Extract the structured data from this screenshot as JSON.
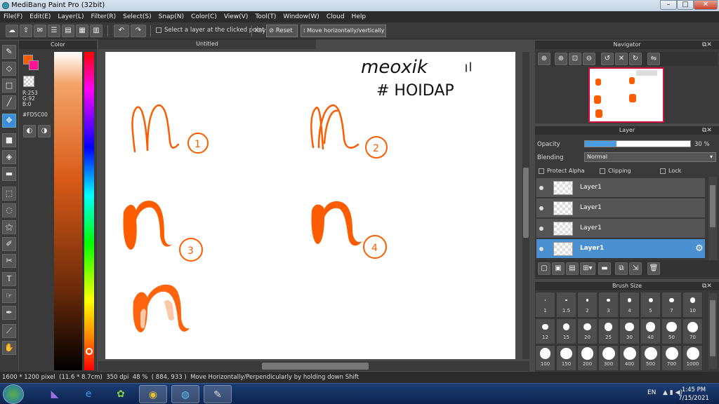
{
  "window": {
    "title": "MediBang Paint Pro (32bit)"
  },
  "menu": [
    "File(F)",
    "Edit(E)",
    "Layer(L)",
    "Filter(R)",
    "Select(S)",
    "Snap(N)",
    "Color(C)",
    "View(V)",
    "Tool(T)",
    "Window(W)",
    "Cloud",
    "Help"
  ],
  "toolbar": {
    "select_layer_label": "Select a layer at the clicked point",
    "key_label": "Key",
    "reset_label": "Reset",
    "move_label": "Move horizontally/vertically"
  },
  "color_panel": {
    "title": "Color",
    "r": "R:253",
    "g": "G:92",
    "b": "B:0",
    "hex": "#FD5C00",
    "fg_color": "#fd5c00",
    "bg_color": "#ff1493"
  },
  "canvas": {
    "tab": "Untitled",
    "handwriting_line1": "meoxik",
    "handwriting_line2": "# HOIDAP",
    "numbers": [
      "1",
      "2",
      "3",
      "4"
    ]
  },
  "navigator": {
    "title": "Navigator"
  },
  "layer_panel": {
    "title": "Layer",
    "opacity_label": "Opacity",
    "opacity_value": "30 %",
    "opacity_fraction": 0.3,
    "blending_label": "Blending",
    "blending_value": "Normal",
    "protect_alpha": "Protect Alpha",
    "clipping": "Clipping",
    "lock": "Lock",
    "layers": [
      "Layer1",
      "Layer1",
      "Layer1",
      "Layer1"
    ]
  },
  "brush_size": {
    "title": "Brush Size",
    "sizes": [
      "1",
      "1.5",
      "2",
      "3",
      "4",
      "5",
      "7",
      "10",
      "12",
      "15",
      "20",
      "25",
      "30",
      "40",
      "50",
      "70",
      "100",
      "150",
      "200",
      "300",
      "400",
      "500",
      "700",
      "1000"
    ]
  },
  "status": {
    "pixels": "1600 * 1200 pixel",
    "cm": "(11.6 * 8.7cm)",
    "dpi": "350 dpi",
    "zoom": "48 %",
    "coords": "( 884, 933 )",
    "hint": "Move Horizontally/Perpendicularly by holding down Shift"
  },
  "taskbar": {
    "lang": "EN",
    "time": "1:45 PM",
    "date": "7/15/2021"
  }
}
